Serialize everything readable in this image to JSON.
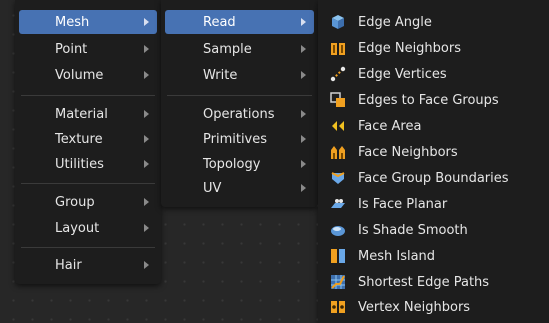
{
  "menu_category": {
    "items": [
      {
        "label": "Mesh",
        "active": true
      },
      {
        "label": "Point"
      },
      {
        "label": "Volume"
      },
      {
        "label": "Material"
      },
      {
        "label": "Texture"
      },
      {
        "label": "Utilities"
      },
      {
        "label": "Group"
      },
      {
        "label": "Layout"
      },
      {
        "label": "Hair"
      }
    ]
  },
  "menu_mesh": {
    "items": [
      {
        "label": "Read",
        "active": true
      },
      {
        "label": "Sample"
      },
      {
        "label": "Write"
      },
      {
        "label": "Operations"
      },
      {
        "label": "Primitives"
      },
      {
        "label": "Topology"
      },
      {
        "label": "UV"
      }
    ]
  },
  "menu_read": {
    "items": [
      {
        "label": "Edge Angle",
        "icon": "edge-angle-icon"
      },
      {
        "label": "Edge Neighbors",
        "icon": "edge-neighbors-icon"
      },
      {
        "label": "Edge Vertices",
        "icon": "edge-vertices-icon"
      },
      {
        "label": "Edges to Face Groups",
        "icon": "edges-to-face-groups-icon"
      },
      {
        "label": "Face Area",
        "icon": "face-area-icon"
      },
      {
        "label": "Face Neighbors",
        "icon": "face-neighbors-icon"
      },
      {
        "label": "Face Group Boundaries",
        "icon": "face-group-boundaries-icon"
      },
      {
        "label": "Is Face Planar",
        "icon": "is-face-planar-icon"
      },
      {
        "label": "Is Shade Smooth",
        "icon": "is-shade-smooth-icon"
      },
      {
        "label": "Mesh Island",
        "icon": "mesh-island-icon"
      },
      {
        "label": "Shortest Edge Paths",
        "icon": "shortest-edge-paths-icon"
      },
      {
        "label": "Vertex Neighbors",
        "icon": "vertex-neighbors-icon"
      }
    ]
  },
  "colors": {
    "highlight": "#4772b3",
    "menu_bg": "#1d1d1d",
    "icon_orange": "#f0a020",
    "icon_blue": "#6aa8e8"
  }
}
